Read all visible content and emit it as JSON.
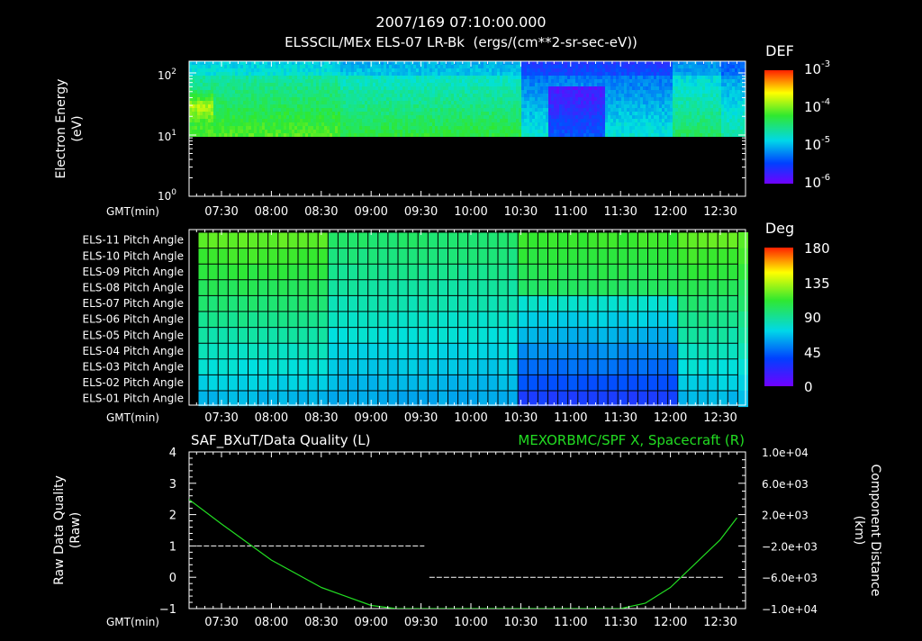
{
  "header": {
    "title": "2007/169 07:10:00.000",
    "subtitle": "ELSSCIL/MEx ELS-07 LR-Bk  (ergs/(cm**2-sr-sec-eV))"
  },
  "time_axis": {
    "label": "GMT(min)",
    "ticks": [
      "07:30",
      "08:00",
      "08:30",
      "09:00",
      "09:30",
      "10:00",
      "10:30",
      "11:00",
      "11:30",
      "12:00",
      "12:30"
    ]
  },
  "chart_data": [
    {
      "type": "heatmap",
      "ylabel_line1": "Electron Energy",
      "ylabel_line2": "(eV)",
      "yticks": [
        {
          "base": "10",
          "exp": "2"
        },
        {
          "base": "10",
          "exp": "1"
        },
        {
          "base": "10",
          "exp": "0"
        }
      ],
      "yscale": "log",
      "ylim_eV": [
        1,
        160
      ],
      "data_floor_eV": 10,
      "colorbar": {
        "title": "DEF",
        "ticks": [
          {
            "base": "10",
            "exp": "-3"
          },
          {
            "base": "10",
            "exp": "-4"
          },
          {
            "base": "10",
            "exp": "-5"
          },
          {
            "base": "10",
            "exp": "-6"
          }
        ]
      },
      "colors": {
        "low": "#7000ff",
        "mid_blue": "#0050ff",
        "cyan": "#00e0e0",
        "green": "#30e830",
        "yellow": "#ffff00",
        "high": "#ff2000"
      }
    },
    {
      "type": "heatmap",
      "rows": [
        "ELS-11 Pitch Angle",
        "ELS-10 Pitch Angle",
        "ELS-09 Pitch Angle",
        "ELS-08 Pitch Angle",
        "ELS-07 Pitch Angle",
        "ELS-06 Pitch Angle",
        "ELS-05 Pitch Angle",
        "ELS-04 Pitch Angle",
        "ELS-03 Pitch Angle",
        "ELS-02 Pitch Angle",
        "ELS-01 Pitch Angle"
      ],
      "colorbar": {
        "title": "Deg",
        "ticks": [
          "180",
          "135",
          "90",
          "45",
          "0"
        ]
      },
      "grid": true
    },
    {
      "type": "line",
      "title_left": "SAF_BXuT/Data Quality (L)",
      "title_right": "MEXORBMC/SPF X, Spacecraft (R)",
      "ylabel_left_line1": "Raw Data Quality",
      "ylabel_left_line2": "(Raw)",
      "ylabel_right_line1": "Component Distance",
      "ylabel_right_line2": "(km)",
      "yticks_left": [
        "4",
        "3",
        "2",
        "1",
        "0",
        "−1"
      ],
      "yticks_right": [
        "1.0e+04",
        "6.0e+03",
        "2.0e+03",
        "−2.0e+03",
        "−6.0e+03",
        "−1.0e+04"
      ],
      "ylim_left": [
        -1,
        4
      ],
      "ylim_right": [
        -10000,
        10000
      ],
      "series": [
        {
          "name": "SAF_BXuT/Data Quality",
          "axis": "left",
          "color": "#ffffff",
          "style": "dashed",
          "segments": [
            {
              "x": [
                "07:15",
                "09:32"
              ],
              "y": [
                1,
                1
              ]
            },
            {
              "x": [
                "09:35",
                "12:32"
              ],
              "y": [
                0,
                0
              ]
            }
          ]
        },
        {
          "name": "MEXORBMC/SPF X, Spacecraft",
          "axis": "right",
          "color": "#22dd22",
          "x": [
            "07:10",
            "07:30",
            "08:00",
            "08:30",
            "09:00",
            "09:15",
            "11:30",
            "11:45",
            "12:00",
            "12:30",
            "12:40"
          ],
          "y": [
            4000,
            800,
            -3800,
            -7300,
            -9600,
            -10000,
            -10000,
            -9300,
            -7300,
            -1200,
            1600
          ]
        }
      ]
    }
  ]
}
